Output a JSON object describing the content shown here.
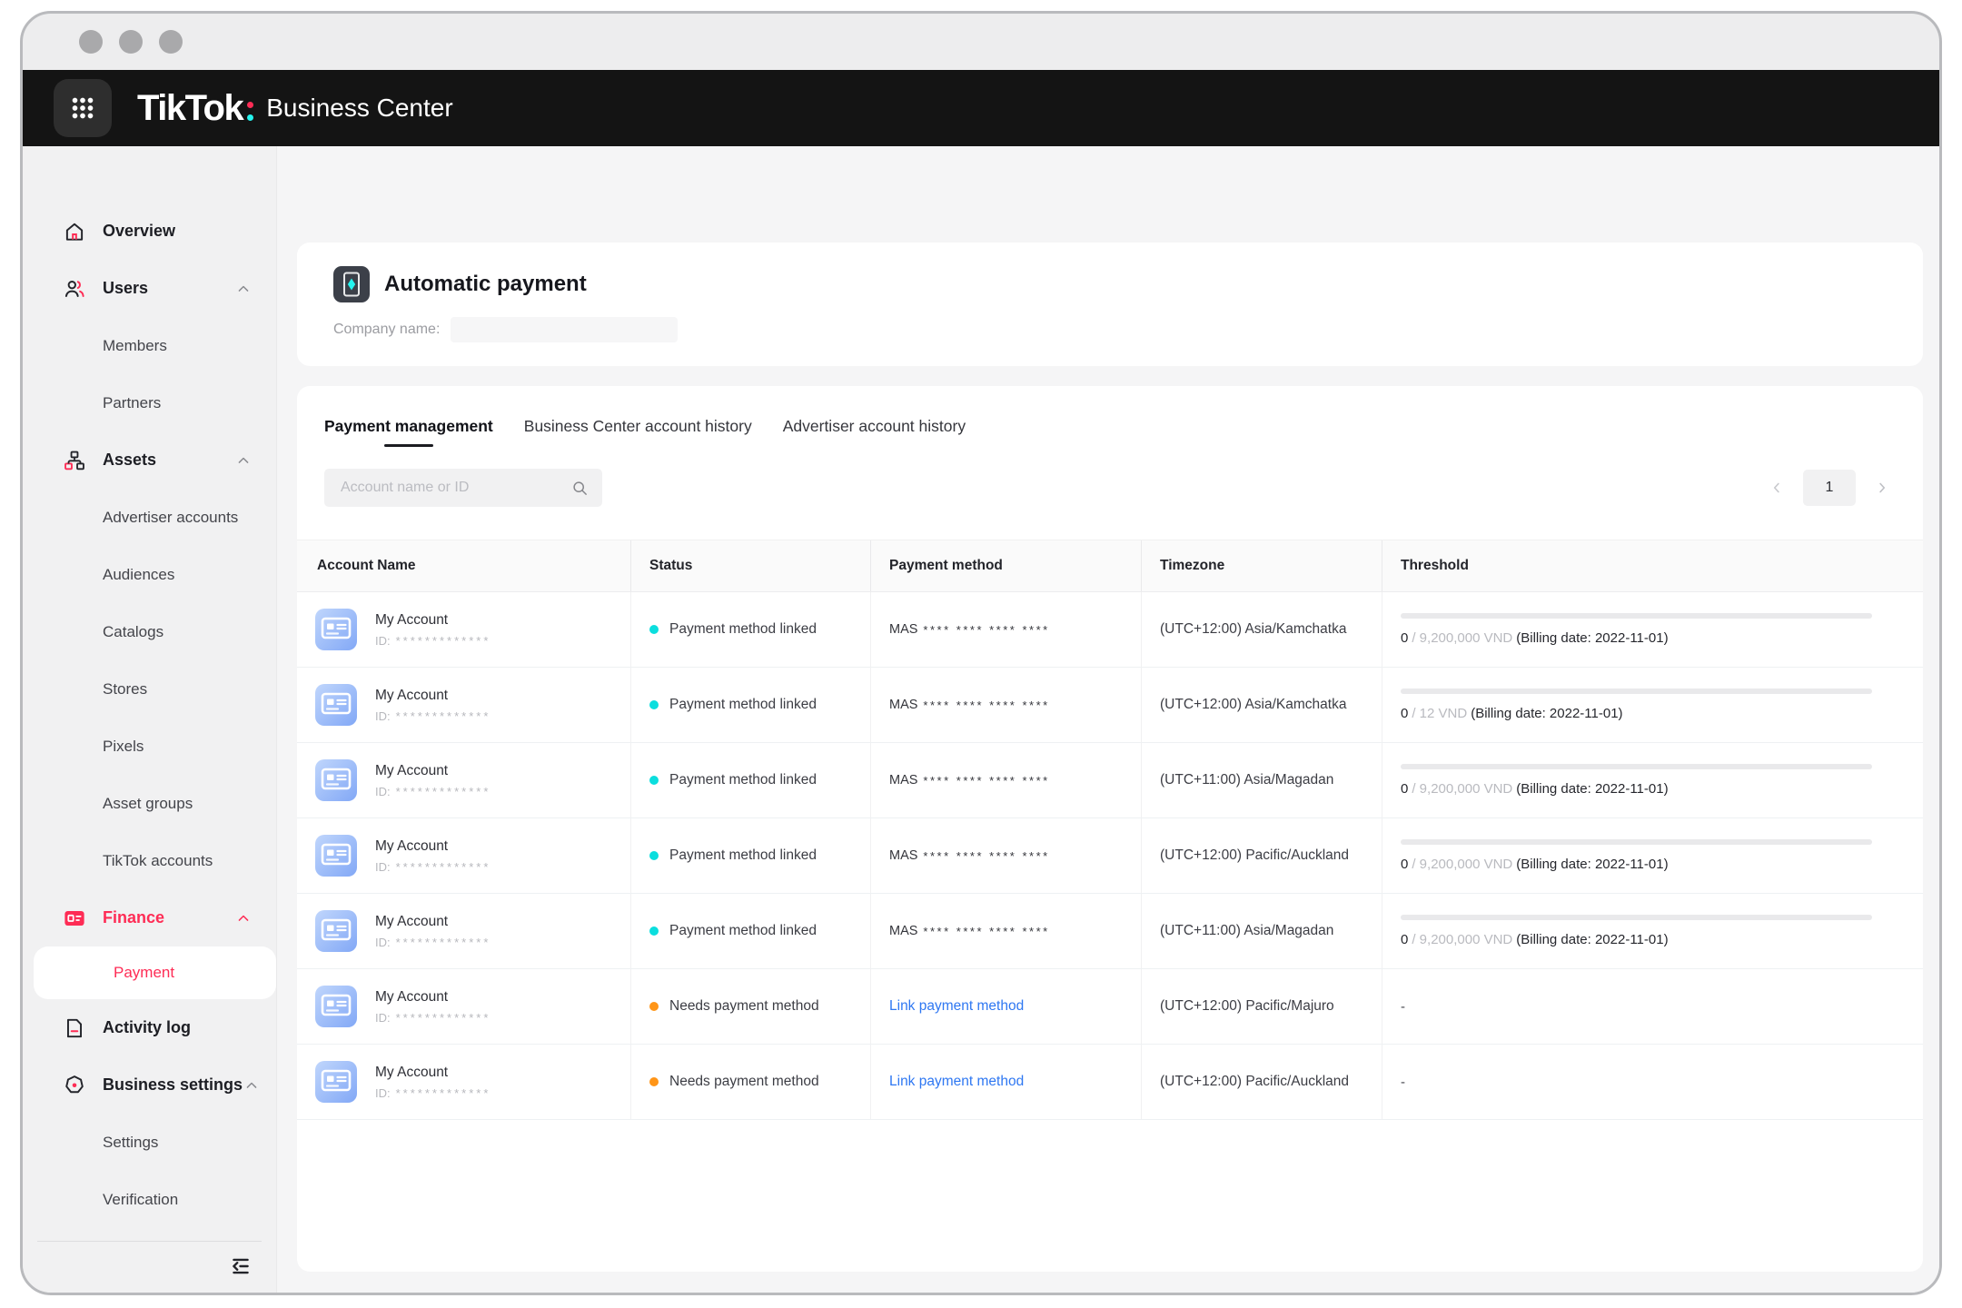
{
  "brand": {
    "name": "TikTok",
    "product": "Business Center"
  },
  "sidebar": {
    "items": [
      {
        "id": "overview",
        "label": "Overview",
        "icon": "home-icon",
        "level": 0
      },
      {
        "id": "users",
        "label": "Users",
        "icon": "users-icon",
        "level": 0,
        "chevron": true
      },
      {
        "id": "members",
        "label": "Members",
        "level": 1
      },
      {
        "id": "partners",
        "label": "Partners",
        "level": 1
      },
      {
        "id": "assets",
        "label": "Assets",
        "icon": "assets-icon",
        "level": 0,
        "chevron": true
      },
      {
        "id": "advertiser-accounts",
        "label": "Advertiser accounts",
        "level": 1
      },
      {
        "id": "audiences",
        "label": "Audiences",
        "level": 1
      },
      {
        "id": "catalogs",
        "label": "Catalogs",
        "level": 1
      },
      {
        "id": "stores",
        "label": "Stores",
        "level": 1
      },
      {
        "id": "pixels",
        "label": "Pixels",
        "level": 1
      },
      {
        "id": "asset-groups",
        "label": "Asset groups",
        "level": 1
      },
      {
        "id": "tiktok-accounts",
        "label": "TikTok accounts",
        "level": 1
      },
      {
        "id": "finance",
        "label": "Finance",
        "icon": "finance-icon",
        "level": 0,
        "chevron": true,
        "active": true
      },
      {
        "id": "payment",
        "label": "Payment",
        "level": 1,
        "selected": true
      },
      {
        "id": "activity-log",
        "label": "Activity log",
        "icon": "activity-log-icon",
        "level": 0
      },
      {
        "id": "business-settings",
        "label": "Business settings",
        "icon": "business-settings-icon",
        "level": 0,
        "chevron": true
      },
      {
        "id": "settings",
        "label": "Settings",
        "level": 1
      },
      {
        "id": "verification",
        "label": "Verification",
        "level": 1
      }
    ]
  },
  "page": {
    "title": "Automatic payment",
    "company_label": "Company name:",
    "tabs": [
      "Payment management",
      "Business Center account history",
      "Advertiser account history"
    ],
    "active_tab_index": 0,
    "search_placeholder": "Account name or ID",
    "pagination": {
      "current": "1"
    }
  },
  "table": {
    "columns": [
      "Account Name",
      "Status",
      "Payment method",
      "Timezone",
      "Threshold"
    ],
    "rows": [
      {
        "account_name": "My Account",
        "account_id_label": "ID:",
        "account_id_mask": "*************",
        "status": "linked",
        "status_label": "Payment method linked",
        "payment_type": "card",
        "payment_brand": "MAS",
        "payment_mask": "**** **** **** ****",
        "timezone": "(UTC+12:00) Asia/Kamchatka",
        "threshold": {
          "used": "0",
          "limit_display": "/ 9,200,000 VND",
          "billing": "(Billing date: 2022-11-01)"
        }
      },
      {
        "account_name": "My Account",
        "account_id_label": "ID:",
        "account_id_mask": "*************",
        "status": "linked",
        "status_label": "Payment method linked",
        "payment_type": "card",
        "payment_brand": "MAS",
        "payment_mask": "**** **** **** ****",
        "timezone": "(UTC+12:00) Asia/Kamchatka",
        "threshold": {
          "used": "0",
          "limit_display": "/ 12 VND",
          "billing": "(Billing date: 2022-11-01)"
        }
      },
      {
        "account_name": "My Account",
        "account_id_label": "ID:",
        "account_id_mask": "*************",
        "status": "linked",
        "status_label": "Payment method linked",
        "payment_type": "card",
        "payment_brand": "MAS",
        "payment_mask": "**** **** **** ****",
        "timezone": "(UTC+11:00) Asia/Magadan",
        "threshold": {
          "used": "0",
          "limit_display": "/ 9,200,000 VND",
          "billing": "(Billing date: 2022-11-01)"
        }
      },
      {
        "account_name": "My Account",
        "account_id_label": "ID:",
        "account_id_mask": "*************",
        "status": "linked",
        "status_label": "Payment method linked",
        "payment_type": "card",
        "payment_brand": "MAS",
        "payment_mask": "**** **** **** ****",
        "timezone": "(UTC+12:00) Pacific/Auckland",
        "threshold": {
          "used": "0",
          "limit_display": "/ 9,200,000 VND",
          "billing": "(Billing date: 2022-11-01)"
        }
      },
      {
        "account_name": "My Account",
        "account_id_label": "ID:",
        "account_id_mask": "*************",
        "status": "linked",
        "status_label": "Payment method linked",
        "payment_type": "card",
        "payment_brand": "MAS",
        "payment_mask": "**** **** **** ****",
        "timezone": "(UTC+11:00) Asia/Magadan",
        "threshold": {
          "used": "0",
          "limit_display": "/ 9,200,000 VND",
          "billing": "(Billing date: 2022-11-01)"
        }
      },
      {
        "account_name": "My Account",
        "account_id_label": "ID:",
        "account_id_mask": "*************",
        "status": "needs",
        "status_label": "Needs payment method",
        "payment_type": "link",
        "payment_link_label": "Link payment method",
        "timezone": "(UTC+12:00) Pacific/Majuro",
        "threshold": null,
        "threshold_empty": "-"
      },
      {
        "account_name": "My Account",
        "account_id_label": "ID:",
        "account_id_mask": "*************",
        "status": "needs",
        "status_label": "Needs payment method",
        "payment_type": "link",
        "payment_link_label": "Link payment method",
        "timezone": "(UTC+12:00) Pacific/Auckland",
        "threshold": null,
        "threshold_empty": "-"
      }
    ]
  },
  "colors": {
    "accent": "#fe2c55",
    "status_linked": "#0bdede",
    "status_needs": "#ff9517",
    "link_blue": "#2e77f2"
  }
}
